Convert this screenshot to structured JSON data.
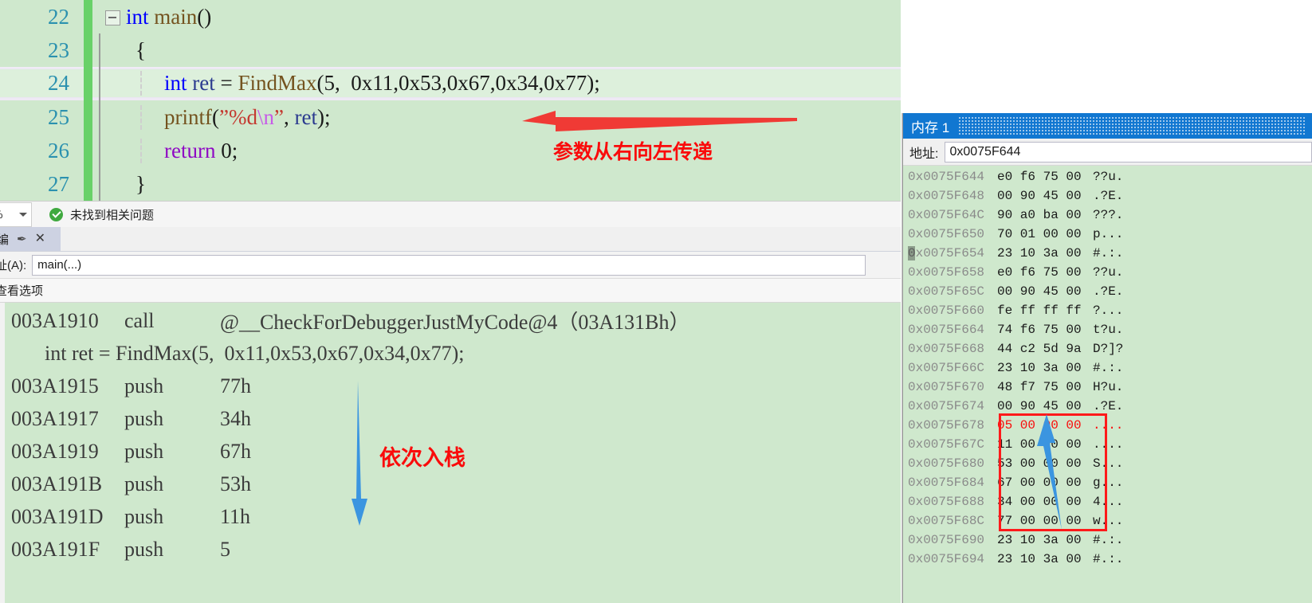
{
  "editor": {
    "lines": [
      {
        "no": "22",
        "fold": true,
        "highlight": false,
        "indent": 0,
        "tokens": [
          {
            "t": "int",
            "c": "kw"
          },
          {
            "t": " ",
            "c": "plain"
          },
          {
            "t": "main",
            "c": "fn"
          },
          {
            "t": "()",
            "c": "plain"
          }
        ]
      },
      {
        "no": "23",
        "fold": false,
        "highlight": false,
        "indent": 1,
        "tokens": [
          {
            "t": "{",
            "c": "plain"
          }
        ]
      },
      {
        "no": "24",
        "fold": false,
        "highlight": true,
        "indent": 2,
        "tokens": [
          {
            "t": "int",
            "c": "kw"
          },
          {
            "t": " ",
            "c": "plain"
          },
          {
            "t": "ret",
            "c": "var"
          },
          {
            "t": " = ",
            "c": "plain"
          },
          {
            "t": "FindMax",
            "c": "fn"
          },
          {
            "t": "(5,  0x11,0x53,0x67,0x34,0x77);",
            "c": "plain"
          }
        ]
      },
      {
        "no": "25",
        "fold": false,
        "highlight": false,
        "indent": 2,
        "tokens": [
          {
            "t": "printf",
            "c": "fn"
          },
          {
            "t": "(",
            "c": "plain"
          },
          {
            "t": "”%d",
            "c": "str"
          },
          {
            "t": "\\n",
            "c": "esc"
          },
          {
            "t": "”",
            "c": "str"
          },
          {
            "t": ", ",
            "c": "plain"
          },
          {
            "t": "ret",
            "c": "var"
          },
          {
            "t": ");",
            "c": "plain"
          }
        ]
      },
      {
        "no": "26",
        "fold": false,
        "highlight": false,
        "indent": 2,
        "tokens": [
          {
            "t": "return",
            "c": "kw2"
          },
          {
            "t": " ",
            "c": "plain"
          },
          {
            "t": "0",
            "c": "num"
          },
          {
            "t": ";",
            "c": "plain"
          }
        ]
      },
      {
        "no": "27",
        "fold": false,
        "highlight": false,
        "indent": 1,
        "tokens": [
          {
            "t": "}",
            "c": "plain"
          }
        ]
      }
    ]
  },
  "status_bar": {
    "zoom_value": "%",
    "message": "未找到相关问题"
  },
  "disasm_window": {
    "tab_label": "编",
    "pin_glyph": "✒",
    "close_glyph": "✕",
    "address_label": "址(A):",
    "address_value": "main(...)",
    "view_options_label": "查看选项",
    "lines": [
      {
        "kind": "asm",
        "addr": "003A1910",
        "op": "call",
        "arg": "@__CheckForDebuggerJustMyCode@4（03A131Bh）"
      },
      {
        "kind": "source",
        "text": "int ret = FindMax(5,  0x11,0x53,0x67,0x34,0x77);"
      },
      {
        "kind": "asm",
        "addr": "003A1915",
        "op": "push",
        "arg": "77h"
      },
      {
        "kind": "asm",
        "addr": "003A1917",
        "op": "push",
        "arg": "34h"
      },
      {
        "kind": "asm",
        "addr": "003A1919",
        "op": "push",
        "arg": "67h"
      },
      {
        "kind": "asm",
        "addr": "003A191B",
        "op": "push",
        "arg": "53h"
      },
      {
        "kind": "asm",
        "addr": "003A191D",
        "op": "push",
        "arg": "11h"
      },
      {
        "kind": "asm",
        "addr": "003A191F",
        "op": "push",
        "arg": "5"
      }
    ]
  },
  "annotations": {
    "param_order": "参数从右向左传递",
    "push_order": "依次入栈",
    "red": "#fa0b0b",
    "blue": "#3b95e0"
  },
  "memory_panel": {
    "title": "内存 1",
    "address_label": "地址:",
    "address_value": "0x0075F644",
    "rows": [
      {
        "addr": "0x0075F644",
        "hex": "e0 f6 75 00",
        "ascii": "??u.",
        "red": false,
        "caret": false
      },
      {
        "addr": "0x0075F648",
        "hex": "00 90 45 00",
        "ascii": ".?E.",
        "red": false,
        "caret": false
      },
      {
        "addr": "0x0075F64C",
        "hex": "90 a0 ba 00",
        "ascii": "???.",
        "red": false,
        "caret": false
      },
      {
        "addr": "0x0075F650",
        "hex": "70 01 00 00",
        "ascii": "p...",
        "red": false,
        "caret": false
      },
      {
        "addr": "0x0075F654",
        "hex": "23 10 3a 00",
        "ascii": "#.:.",
        "red": false,
        "caret": true
      },
      {
        "addr": "0x0075F658",
        "hex": "e0 f6 75 00",
        "ascii": "??u.",
        "red": false,
        "caret": false
      },
      {
        "addr": "0x0075F65C",
        "hex": "00 90 45 00",
        "ascii": ".?E.",
        "red": false,
        "caret": false
      },
      {
        "addr": "0x0075F660",
        "hex": "fe ff ff ff",
        "ascii": "?...",
        "red": false,
        "caret": false
      },
      {
        "addr": "0x0075F664",
        "hex": "74 f6 75 00",
        "ascii": "t?u.",
        "red": false,
        "caret": false
      },
      {
        "addr": "0x0075F668",
        "hex": "44 c2 5d 9a",
        "ascii": "D?]?",
        "red": false,
        "caret": false
      },
      {
        "addr": "0x0075F66C",
        "hex": "23 10 3a 00",
        "ascii": "#.:.",
        "red": false,
        "caret": false
      },
      {
        "addr": "0x0075F670",
        "hex": "48 f7 75 00",
        "ascii": "H?u.",
        "red": false,
        "caret": false
      },
      {
        "addr": "0x0075F674",
        "hex": "00 90 45 00",
        "ascii": ".?E.",
        "red": false,
        "caret": false
      },
      {
        "addr": "0x0075F678",
        "hex": "05 00 00 00",
        "ascii": "....",
        "red": true,
        "caret": false
      },
      {
        "addr": "0x0075F67C",
        "hex": "11 00 00 00",
        "ascii": "....",
        "red": false,
        "caret": false
      },
      {
        "addr": "0x0075F680",
        "hex": "53 00 00 00",
        "ascii": "S...",
        "red": false,
        "caret": false
      },
      {
        "addr": "0x0075F684",
        "hex": "67 00 00 00",
        "ascii": "g...",
        "red": false,
        "caret": false
      },
      {
        "addr": "0x0075F688",
        "hex": "34 00 00 00",
        "ascii": "4...",
        "red": false,
        "caret": false
      },
      {
        "addr": "0x0075F68C",
        "hex": "77 00 00 00",
        "ascii": "w...",
        "red": false,
        "caret": false
      },
      {
        "addr": "0x0075F690",
        "hex": "23 10 3a 00",
        "ascii": "#.:.",
        "red": false,
        "caret": false
      },
      {
        "addr": "0x0075F694",
        "hex": "23 10 3a 00",
        "ascii": "#.:.",
        "red": false,
        "caret": false
      }
    ],
    "highlight_box_first_row": 13,
    "highlight_box_row_count": 6
  }
}
